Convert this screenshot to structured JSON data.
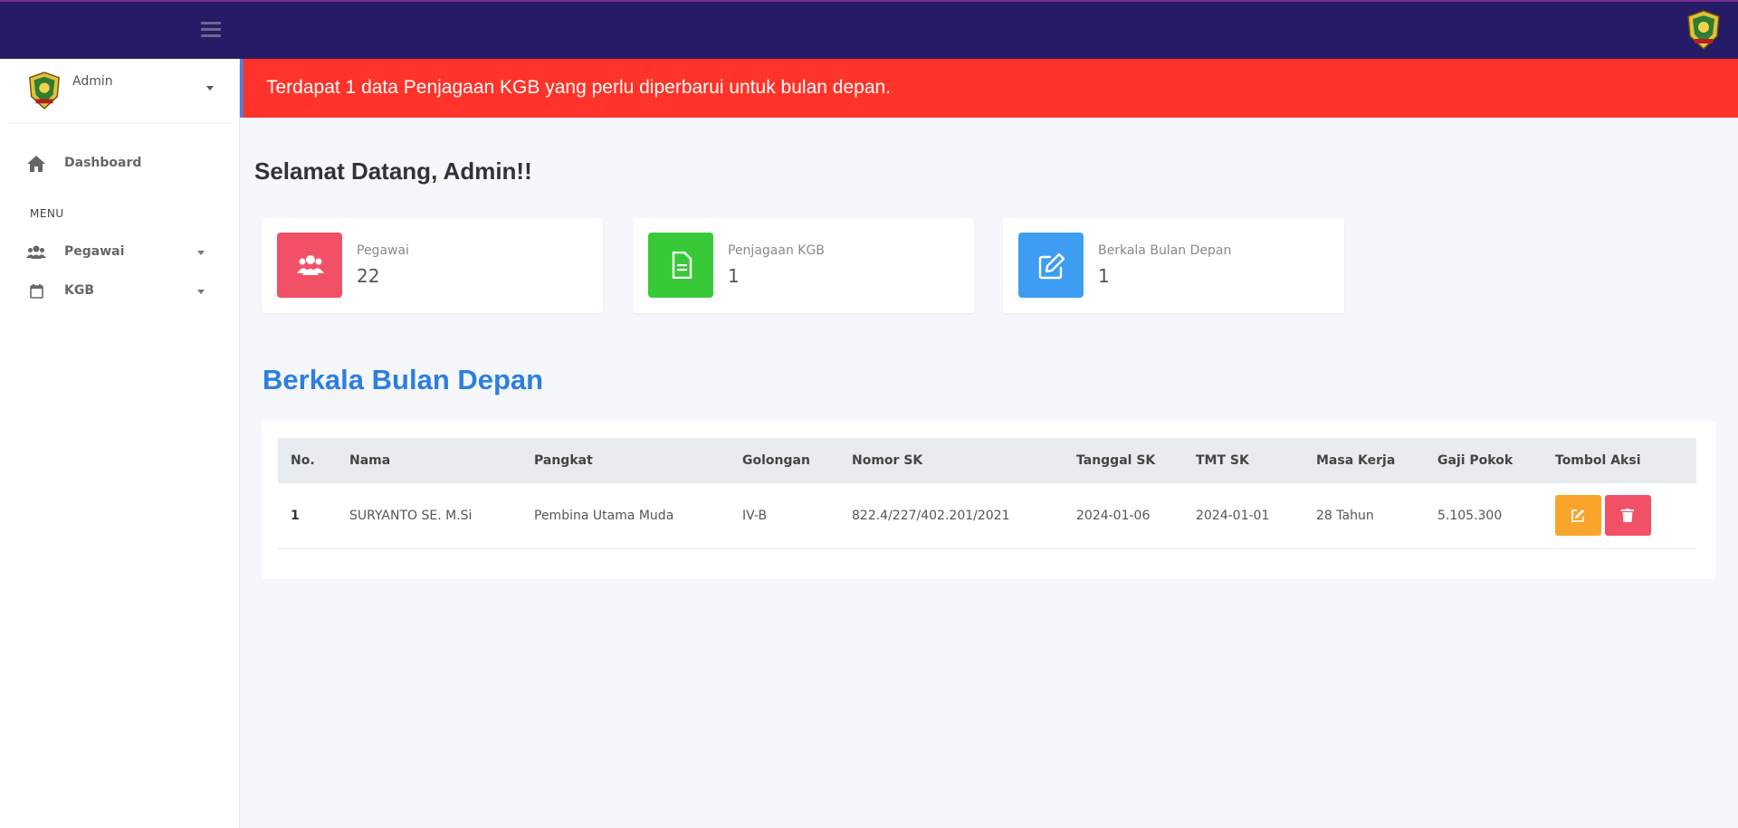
{
  "user": {
    "name": "Admin"
  },
  "sidebar": {
    "items": [
      {
        "label": "Dashboard",
        "icon": "home-icon"
      },
      {
        "label": "Pegawai",
        "icon": "users-icon"
      },
      {
        "label": "KGB",
        "icon": "calendar-icon"
      }
    ],
    "menu_header": "MENU"
  },
  "alert": {
    "text": "Terdapat 1 data Penjagaan KGB yang perlu diperbarui untuk bulan depan."
  },
  "welcome": "Selamat Datang, Admin!!",
  "cards": [
    {
      "label": "Pegawai",
      "value": "22",
      "icon": "users-icon",
      "color": "#f25066"
    },
    {
      "label": "Penjagaan KGB",
      "value": "1",
      "icon": "document-icon",
      "color": "#38c939"
    },
    {
      "label": "Berkala Bulan Depan",
      "value": "1",
      "icon": "edit-icon",
      "color": "#3d9df2"
    }
  ],
  "section": {
    "title": "Berkala Bulan Depan"
  },
  "table": {
    "headers": [
      "No.",
      "Nama",
      "Pangkat",
      "Golongan",
      "Nomor SK",
      "Tanggal SK",
      "TMT SK",
      "Masa Kerja",
      "Gaji Pokok",
      "Tombol Aksi"
    ],
    "rows": [
      {
        "no": "1",
        "nama": "SURYANTO SE. M.Si",
        "pangkat": "Pembina Utama Muda",
        "golongan": "IV-B",
        "nomor_sk": "822.4/227/402.201/2021",
        "tanggal_sk": "2024-01-06",
        "tmt_sk": "2024-01-01",
        "masa_kerja": "28 Tahun",
        "gaji_pokok": "5.105.300"
      }
    ]
  },
  "colors": {
    "topbar": "#261b66",
    "alert": "#ff3329",
    "accent": "#2b7fe0",
    "edit_button": "#f9a52b",
    "delete_button": "#f25066"
  }
}
